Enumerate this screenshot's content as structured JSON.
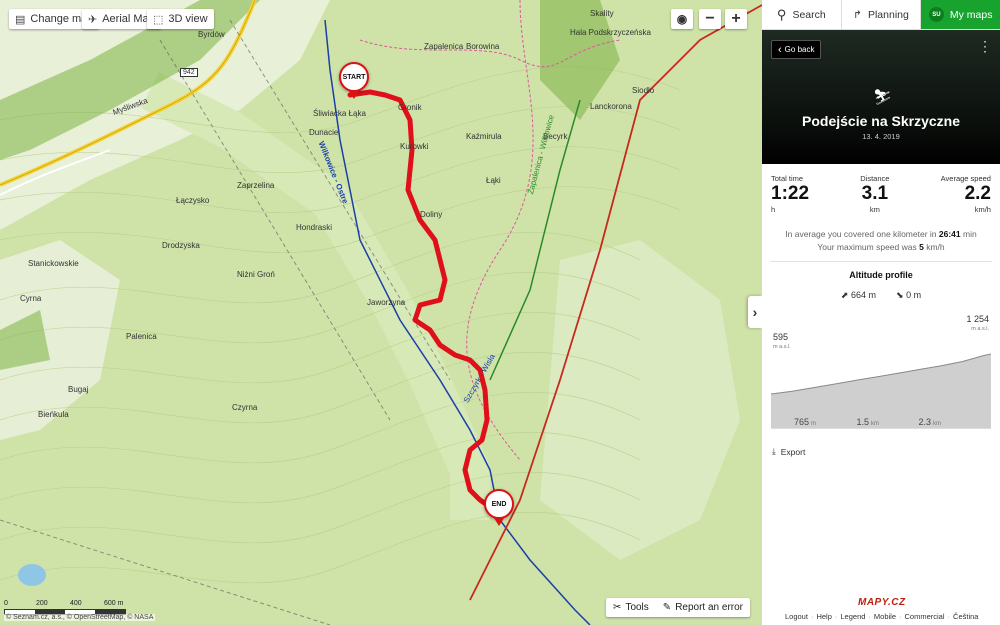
{
  "map_toolbar": {
    "change_map": "Change map",
    "aerial_map": "Aerial Map",
    "view_3d": "3D view",
    "zoom_in": "+",
    "zoom_out": "−"
  },
  "map_labels": {
    "start": "START",
    "end": "END",
    "places": [
      "Byrdów",
      "Zapalenica",
      "Borowina",
      "Skality",
      "Hala Podskrzyczeńska",
      "Siodło",
      "Lanckorona",
      "Becyrk",
      "Kaźmirula",
      "Łąki",
      "Gronik",
      "Kurowki",
      "Doliny",
      "Śliwiacka Łąka",
      "Dunacie",
      "Zaprzelina",
      "Łączysko",
      "Hondraski",
      "Drodzyska",
      "Niżni Groń",
      "Stanickowskie",
      "Cyrna",
      "Jaworzyna",
      "Palenica",
      "Bugaj",
      "Bieńkula",
      "Czyrna",
      "Myśliwska",
      "Wilkowice - Ostre",
      "Szczyrk - Wisła",
      "Zapalenica - Wilkowice"
    ],
    "road_number": "942"
  },
  "scale": {
    "ticks": [
      "0",
      "200",
      "400",
      "600 m"
    ]
  },
  "attribution": "© Seznam.cz, a.s., © OpenStreetMap, © NASA",
  "map_tools": {
    "tools": "Tools",
    "report": "Report an error"
  },
  "panel": {
    "tabs": {
      "search": "Search",
      "planning": "Planning",
      "my_maps": "My maps",
      "avatar": "SU"
    },
    "back": "Go back",
    "title": "Podejście na Skrzyczne",
    "date": "13. 4. 2019",
    "stats": {
      "time_label": "Total time",
      "time_value": "1:22",
      "time_unit": "h",
      "distance_label": "Distance",
      "distance_value": "3.1",
      "distance_unit": "km",
      "speed_label": "Average speed",
      "speed_value": "2.2",
      "speed_unit": "km/h"
    },
    "info_line1_prefix": "In average you covered one kilometer in",
    "info_line1_value": "26:41",
    "info_line1_suffix": "min",
    "info_line2_prefix": "Your maximum speed was",
    "info_line2_value": "5",
    "info_line2_suffix": "km/h",
    "altitude_title": "Altitude profile",
    "ascent": "664 m",
    "descent": "0 m",
    "export": "Export",
    "logo": "MAPY.CZ",
    "footer": [
      "Logout",
      "Help",
      "Legend",
      "Mobile",
      "Commercial",
      "Čeština"
    ]
  },
  "chart_data": {
    "type": "area",
    "title": "Altitude profile",
    "y_min_label": "595",
    "y_max_label": "1 254",
    "y_unit": "m a.s.l.",
    "x_tick_labels": [
      {
        "v": "765",
        "u": "m"
      },
      {
        "v": "1.5",
        "u": "km"
      },
      {
        "v": "2.3",
        "u": "km"
      }
    ],
    "x": [
      0,
      0.3,
      0.6,
      0.9,
      1.2,
      1.5,
      1.8,
      2.1,
      2.4,
      2.7,
      3.0,
      3.1
    ],
    "y": [
      595,
      640,
      700,
      760,
      820,
      880,
      940,
      1000,
      1060,
      1130,
      1230,
      1254
    ],
    "ylim": [
      595,
      1254
    ],
    "xlim": [
      0,
      3.1
    ],
    "fill_color": "#cfcfcf",
    "line_color": "#888888"
  },
  "colors": {
    "route": "#e0101a",
    "accent": "#18a32f",
    "trail_blue": "#1a3fa8",
    "trail_red": "#c8281e",
    "trail_green": "#2a8a2a"
  }
}
